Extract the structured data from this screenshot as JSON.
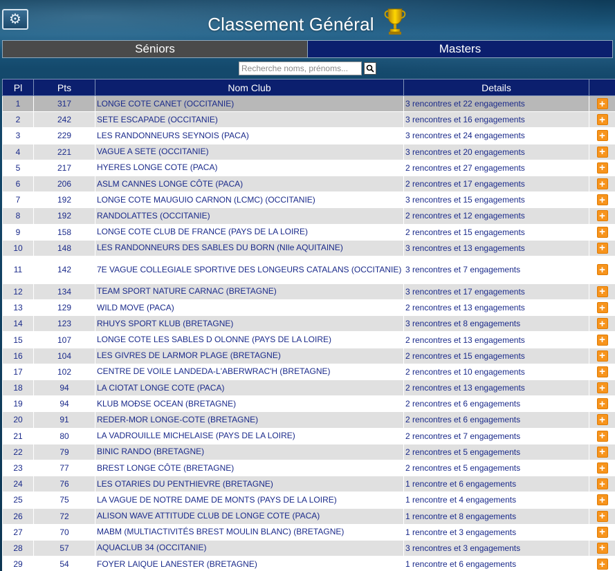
{
  "header": {
    "title": "Classement Général",
    "menu_icon": "gear-icon",
    "trophy_icon": "trophy-icon"
  },
  "tabs": [
    {
      "label": "Séniors"
    },
    {
      "label": "Masters"
    }
  ],
  "search": {
    "placeholder": "Recherche noms, prénoms...",
    "value": ""
  },
  "table": {
    "columns": [
      "Pl",
      "Pts",
      "Nom Club",
      "Details",
      ""
    ],
    "rows": [
      {
        "pl": "1",
        "pts": "317",
        "club": "LONGE COTE CANET (OCCITANIE)",
        "details": "3 rencontres et 22 engagements"
      },
      {
        "pl": "2",
        "pts": "242",
        "club": "SETE ESCAPADE (OCCITANIE)",
        "details": "3 rencontres et 16 engagements"
      },
      {
        "pl": "3",
        "pts": "229",
        "club": "LES RANDONNEURS SEYNOIS (PACA)",
        "details": "3 rencontres et 24 engagements"
      },
      {
        "pl": "4",
        "pts": "221",
        "club": "VAGUE A SETE (OCCITANIE)",
        "details": "3 rencontres et 20 engagements"
      },
      {
        "pl": "5",
        "pts": "217",
        "club": "HYERES LONGE COTE (PACA)",
        "details": "2 rencontres et 27 engagements"
      },
      {
        "pl": "6",
        "pts": "206",
        "club": "ASLM CANNES LONGE CÔTE (PACA)",
        "details": "2 rencontres et 17 engagements"
      },
      {
        "pl": "7",
        "pts": "192",
        "club": "LONGE COTE MAUGUIO CARNON (LCMC) (OCCITANIE)",
        "details": "3 rencontres et 15 engagements"
      },
      {
        "pl": "8",
        "pts": "192",
        "club": "RANDOLATTES (OCCITANIE)",
        "details": "2 rencontres et 12 engagements"
      },
      {
        "pl": "9",
        "pts": "158",
        "club": "LONGE COTE CLUB DE FRANCE (PAYS DE LA LOIRE)",
        "details": "2 rencontres et 15 engagements"
      },
      {
        "pl": "10",
        "pts": "148",
        "club": "LES RANDONNEURS DES SABLES DU BORN (NIle AQUITAINE)",
        "details": "3 rencontres et 13 engagements"
      },
      {
        "pl": "11",
        "pts": "142",
        "club": "7E VAGUE COLLEGIALE SPORTIVE DES LONGEURS CATALANS (OCCITANIE)",
        "details": "3 rencontres et 7 engagements"
      },
      {
        "pl": "12",
        "pts": "134",
        "club": "TEAM SPORT NATURE CARNAC (BRETAGNE)",
        "details": "3 rencontres et 17 engagements"
      },
      {
        "pl": "13",
        "pts": "129",
        "club": "WILD MOVE (PACA)",
        "details": "2 rencontres et 13 engagements"
      },
      {
        "pl": "14",
        "pts": "123",
        "club": "RHUYS SPORT KLUB (BRETAGNE)",
        "details": "3 rencontres et 8 engagements"
      },
      {
        "pl": "15",
        "pts": "107",
        "club": "LONGE COTE LES SABLES D OLONNE (PAYS DE LA LOIRE)",
        "details": "2 rencontres et 13 engagements"
      },
      {
        "pl": "16",
        "pts": "104",
        "club": "LES GIVRES DE LARMOR PLAGE (BRETAGNE)",
        "details": "2 rencontres et 15 engagements"
      },
      {
        "pl": "17",
        "pts": "102",
        "club": "CENTRE DE VOILE LANDEDA-L'ABERWRAC'H (BRETAGNE)",
        "details": "2 rencontres et 10 engagements"
      },
      {
        "pl": "18",
        "pts": "94",
        "club": "LA CIOTAT LONGE COTE (PACA)",
        "details": "2 rencontres et 13 engagements"
      },
      {
        "pl": "19",
        "pts": "94",
        "club": "KLUB MOĐSE OCEAN (BRETAGNE)",
        "details": "2 rencontres et 6 engagements"
      },
      {
        "pl": "20",
        "pts": "91",
        "club": "REDER-MOR LONGE-COTE (BRETAGNE)",
        "details": "2 rencontres et 6 engagements"
      },
      {
        "pl": "21",
        "pts": "80",
        "club": "LA VADROUILLE MICHELAISE (PAYS DE LA LOIRE)",
        "details": "2 rencontres et 7 engagements"
      },
      {
        "pl": "22",
        "pts": "79",
        "club": "BINIC RANDO (BRETAGNE)",
        "details": "2 rencontres et 5 engagements"
      },
      {
        "pl": "23",
        "pts": "77",
        "club": "BREST LONGE CÔTE (BRETAGNE)",
        "details": "2 rencontres et 5 engagements"
      },
      {
        "pl": "24",
        "pts": "76",
        "club": "LES OTARIES DU PENTHIEVRE (BRETAGNE)",
        "details": "1 rencontre et 6 engagements"
      },
      {
        "pl": "25",
        "pts": "75",
        "club": "LA VAGUE DE NOTRE DAME DE MONTS (PAYS DE LA LOIRE)",
        "details": "1 rencontre et 4 engagements"
      },
      {
        "pl": "26",
        "pts": "72",
        "club": "ALISON WAVE ATTITUDE CLUB DE LONGE COTE (PACA)",
        "details": "1 rencontre et 8 engagements"
      },
      {
        "pl": "27",
        "pts": "70",
        "club": "MABM (MULTIACTIVITÉS BREST MOULIN BLANC) (BRETAGNE)",
        "details": "1 rencontre et 3 engagements"
      },
      {
        "pl": "28",
        "pts": "57",
        "club": "AQUACLUB 34 (OCCITANIE)",
        "details": "3 rencontres et 3 engagements"
      },
      {
        "pl": "29",
        "pts": "54",
        "club": "FOYER LAIQUE LANESTER (BRETAGNE)",
        "details": "1 rencontre et 6 engagements"
      }
    ],
    "expand_label": "+"
  },
  "colors": {
    "header_bg": "#0b1f6e",
    "tab_inactive": "#4a4a4a",
    "text_link": "#1a2a8a",
    "expand_button": "#f7941d"
  }
}
